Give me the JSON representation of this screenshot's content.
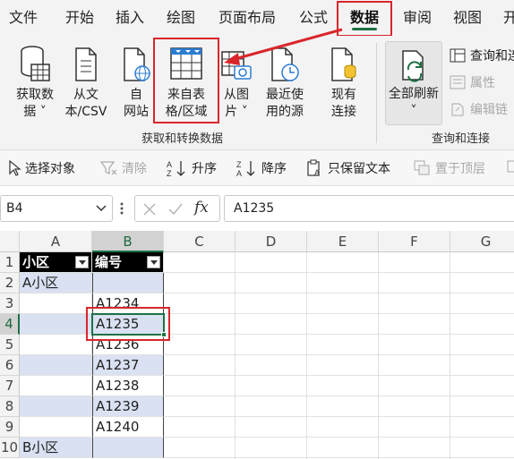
{
  "menu": {
    "tabs": [
      "文件",
      "开始",
      "插入",
      "绘图",
      "页面布局",
      "公式",
      "数据",
      "审阅",
      "视图",
      "开"
    ],
    "active_tab": "数据"
  },
  "ribbon": {
    "get_data": {
      "label": "获取数据",
      "label2": "据",
      "l1": "获取数",
      "l2": "据 ˅"
    },
    "from_csv": {
      "l1": "从文",
      "l2": "本/CSV"
    },
    "from_web": {
      "l1": "自",
      "l2": "网站"
    },
    "from_table": {
      "l1": "来自表",
      "l2": "格/区域"
    },
    "from_picture": {
      "l1": "从图",
      "l2": "片 ˅"
    },
    "recent_sources": {
      "l1": "最近使",
      "l2": "用的源"
    },
    "existing_conn": {
      "l1": "现有",
      "l2": "连接"
    },
    "group1_label": "获取和转换数据",
    "refresh_all": {
      "l1": "全部刷新",
      "l2": "˅"
    },
    "queries_conn": "查询和连",
    "properties": "属性",
    "edit_links": "编辑链",
    "group2_label": "查询和连接"
  },
  "toolbar": {
    "select_objects": "选择对象",
    "clear": "清除",
    "sort_asc": "升序",
    "sort_desc": "降序",
    "keep_text": "只保留文本",
    "bring_top": "置于顶层"
  },
  "formula_bar": {
    "name_box": "B4",
    "fx": "fx",
    "value": "A1235"
  },
  "grid": {
    "columns": [
      "A",
      "B",
      "C",
      "D",
      "E",
      "F",
      "G"
    ],
    "rows": [
      "1",
      "2",
      "3",
      "4",
      "5",
      "6",
      "7",
      "8",
      "9",
      "10"
    ],
    "header_a": "小区",
    "header_b": "编号",
    "a2": "A小区",
    "b3": "A1234",
    "b4": "A1235",
    "b5": "A1236",
    "b6": "A1237",
    "b7": "A1238",
    "b8": "A1239",
    "b9": "A1240",
    "a10": "B小区"
  },
  "colors": {
    "accent": "#1e7145",
    "highlight": "#d9262b",
    "band": "#d9e1f2"
  }
}
